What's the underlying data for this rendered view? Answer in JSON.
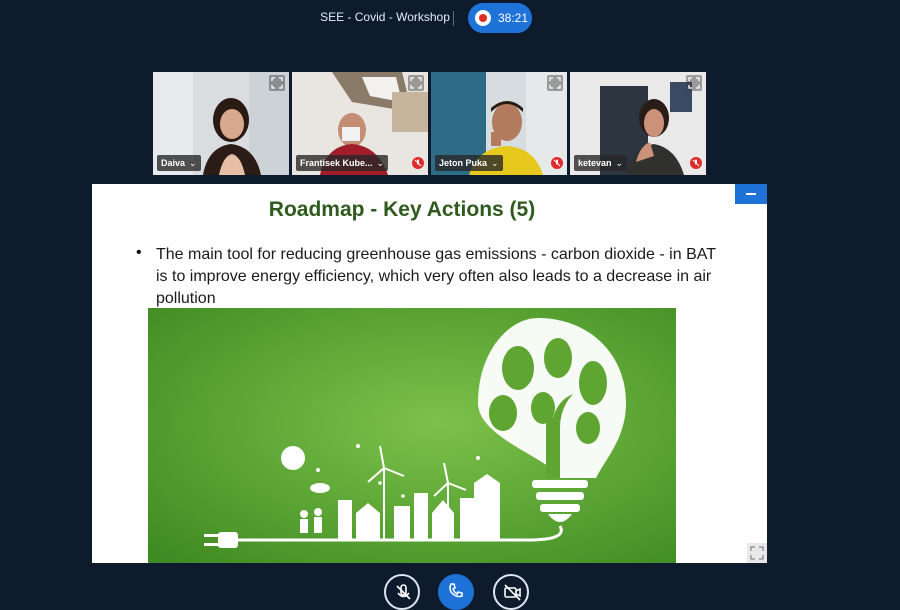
{
  "meeting": {
    "title": "SEE - Covid - Workshop",
    "timer": "38:21",
    "record_icon": "record-icon"
  },
  "participants": [
    {
      "name": "Daiva",
      "muted": false,
      "active": true
    },
    {
      "name": "Frantisek Kube...",
      "muted": true,
      "active": false
    },
    {
      "name": "Jeton Puka",
      "muted": true,
      "active": false
    },
    {
      "name": "ketevan",
      "muted": true,
      "active": false
    }
  ],
  "slide": {
    "title": "Roadmap - Key Actions  (5)",
    "bullet": "•",
    "text": "The main tool for reducing greenhouse gas emissions - carbon dioxide - in BAT is to improve energy efficiency, which very often also leads to a decrease in air pollution",
    "image_icon": "green-energy-lightbulb-illustration"
  },
  "controls": {
    "mic_icon": "microphone-muted-icon",
    "call_icon": "phone-icon",
    "camera_icon": "camera-off-icon"
  },
  "colors": {
    "background": "#0d1b2d",
    "accent": "#1f72d8",
    "muted_badge": "#e02b2b",
    "slide_title": "#2e5a1e",
    "slide_image_green": "#5ea532"
  }
}
